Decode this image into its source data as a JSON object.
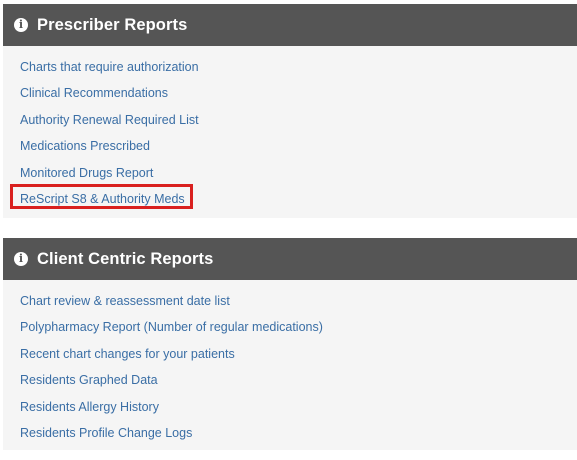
{
  "prescriber_reports": {
    "title": "Prescriber Reports",
    "icon": "info-circle-icon",
    "links": [
      "Charts that require authorization",
      "Clinical Recommendations",
      "Authority Renewal Required List",
      "Medications Prescribed",
      "Monitored Drugs Report",
      "ReScript S8 & Authority Meds"
    ],
    "highlighted_link": "ReScript S8 & Authority Meds",
    "highlight_color": "#d9201f"
  },
  "client_centric_reports": {
    "title": "Client Centric Reports",
    "icon": "info-circle-icon",
    "links": [
      "Chart review & reassessment date list",
      "Polypharmacy Report (Number of regular medications)",
      "Recent chart changes for your patients",
      "Residents Graphed Data",
      "Residents Allergy History",
      "Residents Profile Change Logs"
    ]
  },
  "colors": {
    "header_bg": "#555555",
    "panel_bg": "#f5f5f5",
    "link": "#3a6ea5"
  }
}
